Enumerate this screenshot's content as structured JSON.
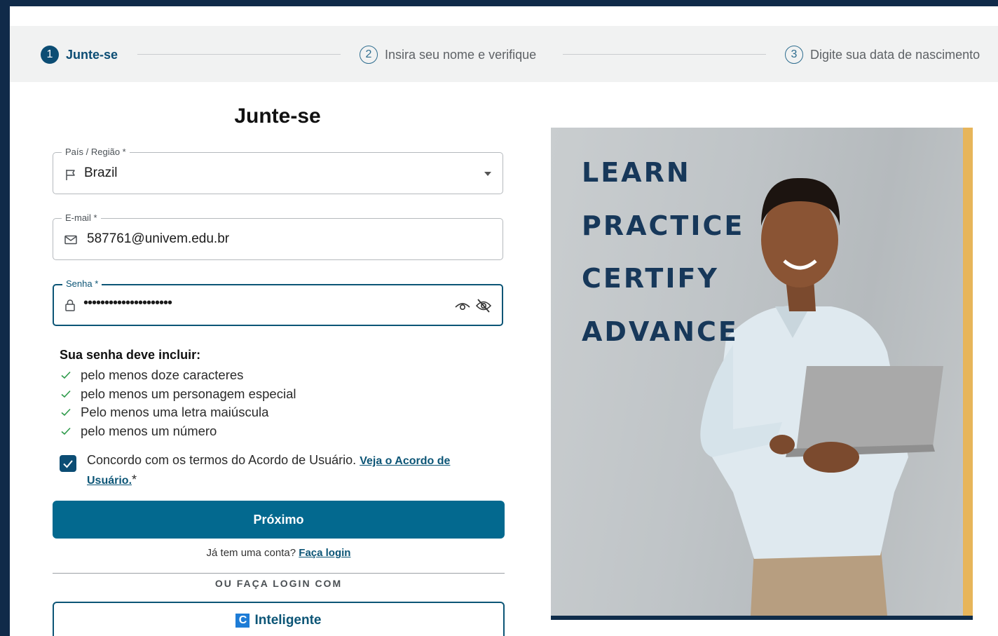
{
  "stepper": {
    "steps": [
      {
        "number": "1",
        "label": "Junte-se",
        "state": "active"
      },
      {
        "number": "2",
        "label": "Insira seu nome e verifique",
        "state": "pending"
      },
      {
        "number": "3",
        "label": "Digite sua data de nascimento",
        "state": "pending"
      }
    ]
  },
  "form": {
    "title": "Junte-se",
    "country": {
      "label": "País / Região *",
      "value": "Brazil",
      "icon": "flag-icon"
    },
    "email": {
      "label": "E-mail  *",
      "value": "587761@univem.edu.br",
      "icon": "mail-icon"
    },
    "password": {
      "label": "Senha *",
      "value": "•••••••••••••••••••••",
      "icon": "lock-icon"
    },
    "requirements": {
      "title": "Sua senha deve incluir:",
      "items": [
        "pelo menos doze caracteres",
        "pelo menos um personagem especial",
        "Pelo menos uma letra maiúscula",
        "pelo menos um número"
      ]
    },
    "agreement": {
      "checked": true,
      "text": "Concordo com os termos do Acordo de Usuário.",
      "link": "Veja o Acordo de Usuário.",
      "asterisk": "*"
    },
    "next_label": "Próximo",
    "login_prompt": "Já tem uma conta?",
    "login_link": "Faça login",
    "or_text": "OU FAÇA LOGIN COM",
    "social_logo": "C",
    "social_label": "Inteligente"
  },
  "promo": {
    "words": [
      "LEARN",
      "PRACTICE",
      "CERTIFY",
      "ADVANCE"
    ]
  },
  "colors": {
    "accent": "#0c4d74",
    "primary_button": "#03698f",
    "frame": "#102a49",
    "promo_accent": "#e7b55a"
  }
}
